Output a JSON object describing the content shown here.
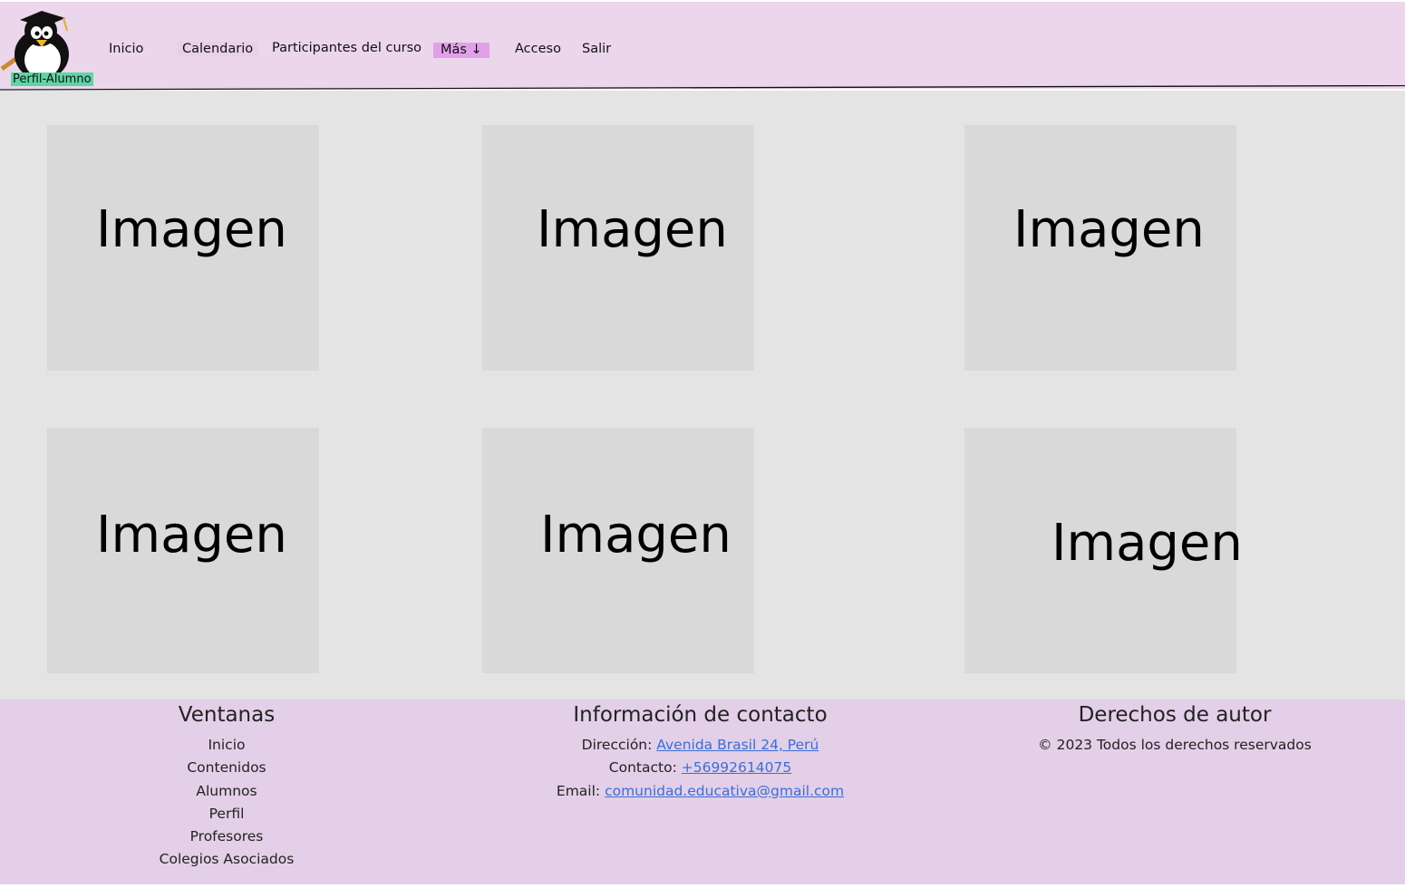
{
  "header": {
    "logo_label": "Perfil-Alumno",
    "nav": {
      "inicio": "Inicio",
      "calendario": "Calendario",
      "participantes": "Participantes del curso",
      "mas": "Más ↓",
      "acceso": "Acceso",
      "salir": "Salir"
    }
  },
  "gallery": {
    "tiles": [
      "Imagen",
      "Imagen",
      "Imagen",
      "Imagen",
      "Imagen",
      "Imagen"
    ]
  },
  "footer": {
    "ventanas": {
      "title": "Ventanas",
      "items": [
        "Inicio",
        "Contenidos",
        "Alumnos",
        "Perfil",
        "Profesores",
        "Colegios Asociados"
      ]
    },
    "contacto": {
      "title": "Información de contacto",
      "direccion_label": "Dirección:",
      "direccion_value": "Avenida Brasil 24, Perú",
      "contacto_label": "Contacto:",
      "contacto_value": "+56992614075",
      "email_label": "Email:",
      "email_value": "comunidad.educativa@gmail.com"
    },
    "derechos": {
      "title": "Derechos de autor",
      "text": "© 2023 Todos los derechos reservados"
    }
  },
  "colors": {
    "header_bg": "#ebd6ec",
    "main_bg": "#e4e4e4",
    "tile_bg": "#d9d9d9",
    "footer_bg": "#e3cfe7",
    "link": "#3a6fd8",
    "logo_label_bg": "#5fd4a4",
    "mas_bg": "#e2a0ea"
  }
}
